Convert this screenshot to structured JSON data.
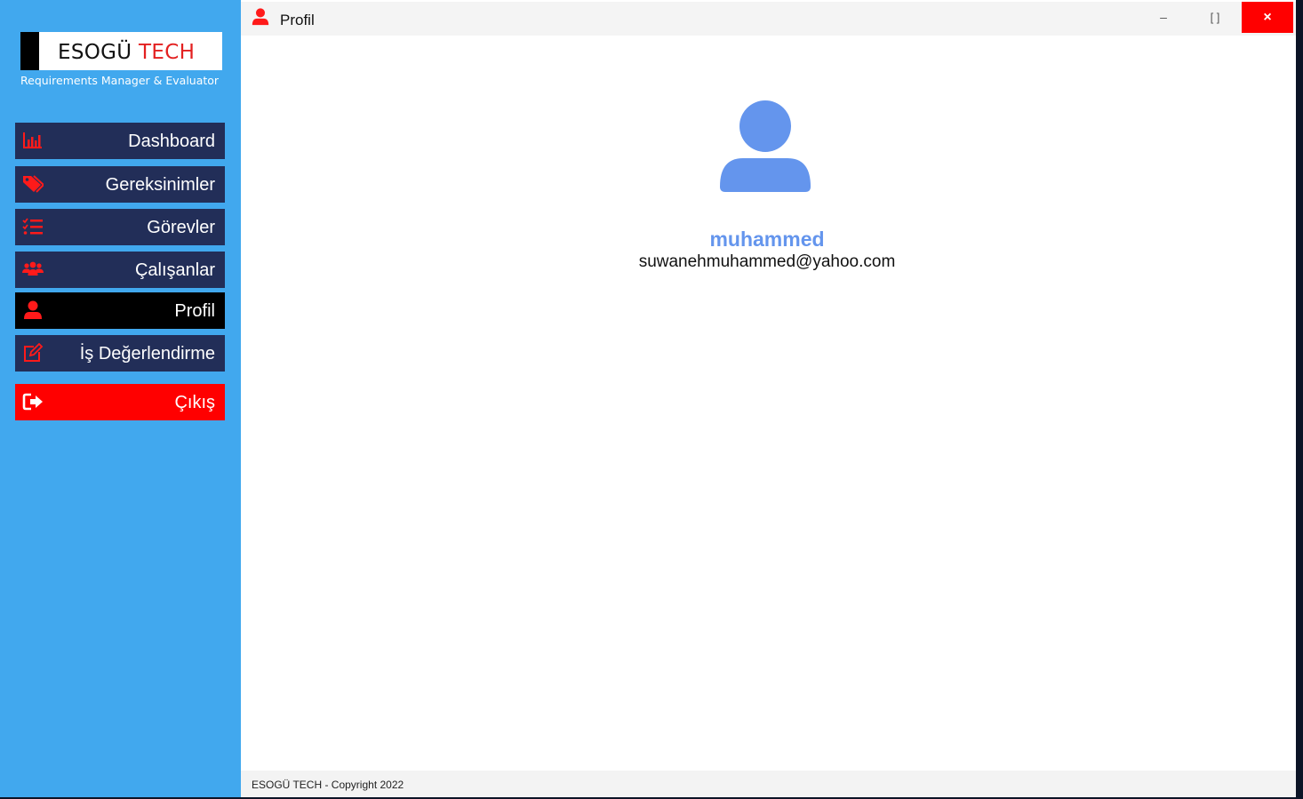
{
  "brand": {
    "name_main": "ESOGÜ",
    "name_accent": "TECH",
    "subtitle": "Requirements Manager & Evaluator"
  },
  "sidebar": {
    "items": [
      {
        "label": "Dashboard",
        "icon": "chart-bar-icon"
      },
      {
        "label": "Gereksinimler",
        "icon": "tags-icon"
      },
      {
        "label": "Görevler",
        "icon": "tasks-list-icon"
      },
      {
        "label": "Çalışanlar",
        "icon": "users-icon"
      },
      {
        "label": "Profil",
        "icon": "user-icon",
        "active": true
      },
      {
        "label": "İş Değerlendirme",
        "icon": "edit-icon"
      },
      {
        "label": "Çıkış",
        "icon": "sign-out-icon"
      }
    ]
  },
  "titlebar": {
    "title": "Profil",
    "minimize_label": "–",
    "maximize_label": "[ ]",
    "close_label": "×"
  },
  "profile": {
    "username": "muhammed",
    "email": "suwanehmuhammed@yahoo.com"
  },
  "footer": {
    "text": "ESOGÜ TECH - Copyright 2022"
  },
  "colors": {
    "sidebar_bg": "#41a8ee",
    "nav_bg": "#222e58",
    "nav_active": "#000000",
    "exit_bg": "#ff0000",
    "icon_red": "#ff1a1a",
    "username_color": "#6495ed",
    "avatar_color": "#6495ed"
  }
}
